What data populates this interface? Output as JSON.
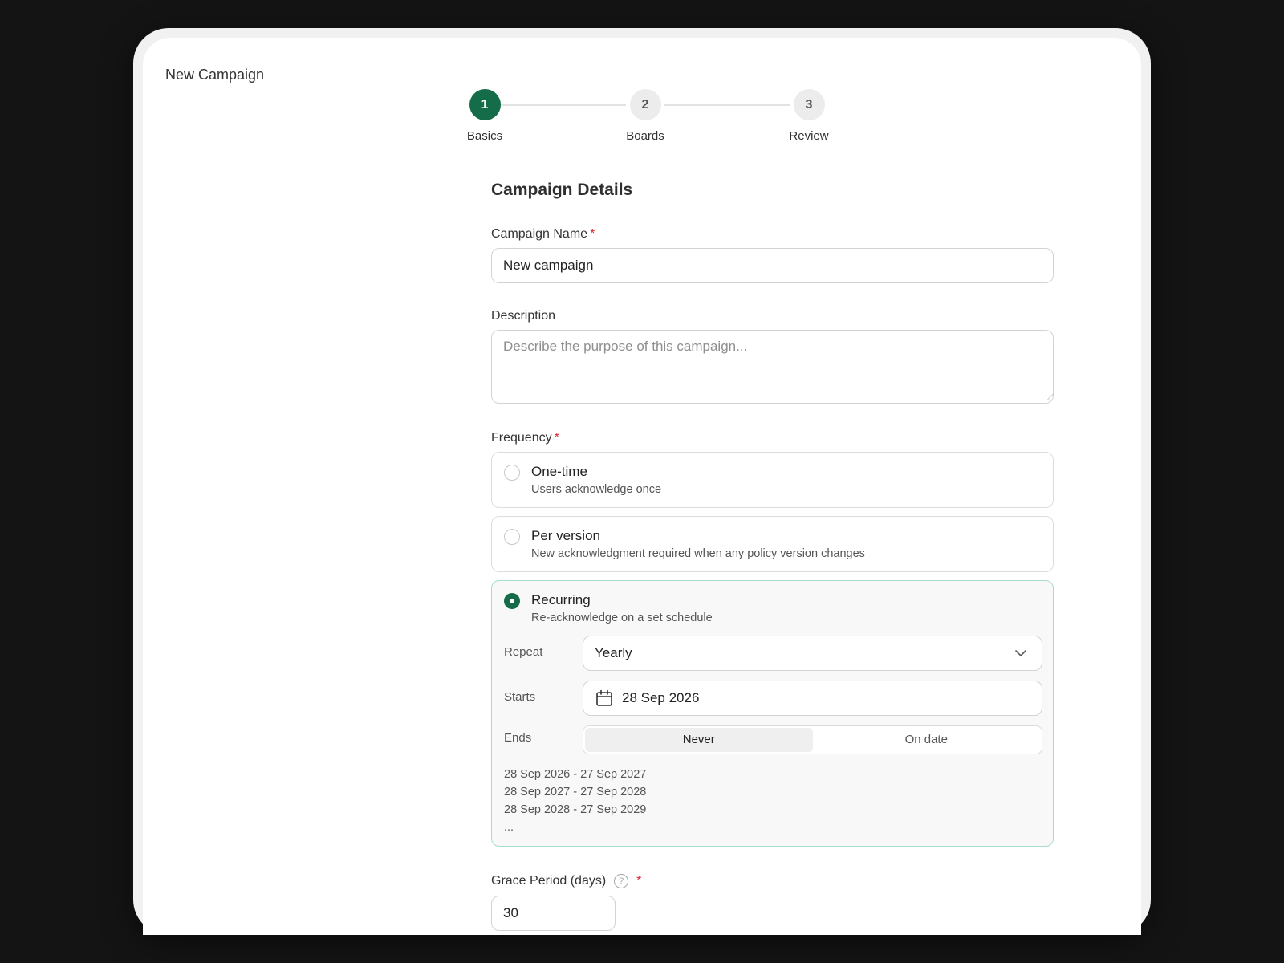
{
  "header": {
    "title": "New Campaign"
  },
  "stepper": {
    "steps": [
      {
        "number": "1",
        "label": "Basics",
        "active": true
      },
      {
        "number": "2",
        "label": "Boards",
        "active": false
      },
      {
        "number": "3",
        "label": "Review",
        "active": false
      }
    ]
  },
  "form": {
    "section_title": "Campaign Details",
    "required_marker": "*",
    "campaign_name": {
      "label": "Campaign Name",
      "value": "New campaign"
    },
    "description": {
      "label": "Description",
      "placeholder": "Describe the purpose of this campaign..."
    },
    "frequency": {
      "label": "Frequency",
      "options": [
        {
          "title": "One-time",
          "description": "Users acknowledge once",
          "selected": false
        },
        {
          "title": "Per version",
          "description": "New acknowledgment required when any policy version changes",
          "selected": false
        },
        {
          "title": "Recurring",
          "description": "Re-acknowledge on a set schedule",
          "selected": true
        }
      ],
      "recurring": {
        "repeat_label": "Repeat",
        "repeat_value": "Yearly",
        "starts_label": "Starts",
        "starts_value": "28 Sep 2026",
        "ends_label": "Ends",
        "ends_options": [
          "Never",
          "On date"
        ],
        "ends_selected": "Never",
        "schedule_preview": [
          "28 Sep 2026 - 27 Sep 2027",
          "28 Sep 2027 - 27 Sep 2028",
          "28 Sep 2028 - 27 Sep 2029",
          "..."
        ]
      }
    },
    "grace_period": {
      "label": "Grace Period (days)",
      "help": "?",
      "value": "30"
    }
  },
  "colors": {
    "accent": "#146c49",
    "selected_border": "#a6dccb",
    "required": "#e0262a"
  }
}
